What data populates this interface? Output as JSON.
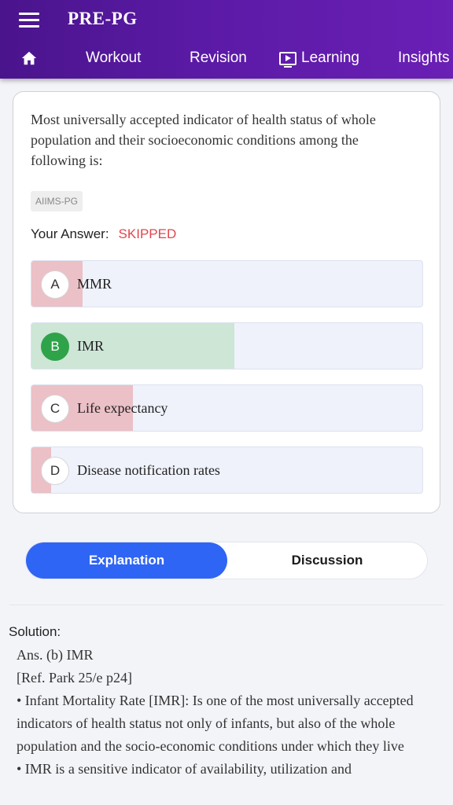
{
  "app": {
    "title": "PRE-PG"
  },
  "icons": {
    "menu": "hamburger-menu-icon",
    "home": "home-icon",
    "learning": "play-screen-icon"
  },
  "nav": {
    "workout": "Workout",
    "revision": "Revision",
    "learning": "Learning",
    "insights": "Insights"
  },
  "question": {
    "text": "Most universally accepted indicator of health status of whole population and their socioeconomic conditions among the following is:",
    "tag": "AIIMS-PG",
    "your_answer_label": "Your Answer:",
    "your_answer_value": "SKIPPED",
    "options": [
      {
        "letter": "A",
        "text": "MMR",
        "response_share": 0.13,
        "correct": false
      },
      {
        "letter": "B",
        "text": "IMR",
        "response_share": 0.52,
        "correct": true
      },
      {
        "letter": "C",
        "text": "Life expectancy",
        "response_share": 0.26,
        "correct": false
      },
      {
        "letter": "D",
        "text": "Disease notification rates",
        "response_share": 0.05,
        "correct": false
      }
    ]
  },
  "tabs": {
    "explanation": "Explanation",
    "discussion": "Discussion",
    "active": "explanation"
  },
  "solution": {
    "label": "Solution:",
    "lines": [
      "Ans. (b) IMR",
      "[Ref. Park 25/e p24]",
      "• Infant Mortality Rate [IMR]: Is one of the most universally accepted indicators of health status not only of infants, but also of the whole population and the socio-economic conditions under which they live",
      "• IMR is a sensitive indicator of availability, utilization and"
    ]
  },
  "colors": {
    "appbar": "#5b1aa6",
    "wrong_fill": "#ebc0c6",
    "correct_fill": "#cde6d6",
    "correct_badge": "#2fa34a",
    "active_tab": "#2f65f4",
    "skipped": "#e0464e"
  }
}
